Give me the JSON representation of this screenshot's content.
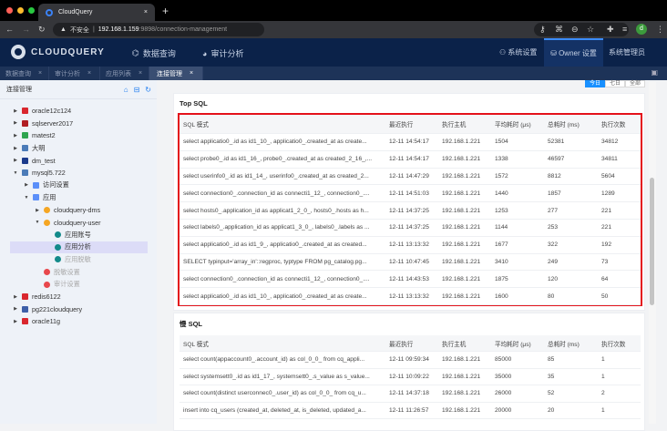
{
  "browser": {
    "tab_title": "CloudQuery",
    "tab_close": "×",
    "new_tab": "+",
    "insecure_label": "不安全",
    "url_host": "192.168.1.159",
    "url_rest": ":9898/connection-management",
    "profile_initial": "d"
  },
  "app": {
    "logo_text": "CLOUDQUERY",
    "nav": [
      "数据查询",
      "审计分析"
    ],
    "right": {
      "system_settings": "系统设置",
      "owner_settings": "Owner 设置",
      "user": "系统管理员"
    }
  },
  "tabs": [
    {
      "label": "数据查询",
      "active": false
    },
    {
      "label": "审计分析",
      "active": false
    },
    {
      "label": "应用列表",
      "active": false
    },
    {
      "label": "连接管理",
      "active": true
    }
  ],
  "sidebar": {
    "title": "连接管理",
    "tree": [
      {
        "label": "oracle12c124",
        "depth": 0,
        "expand": "closed",
        "color": "#d9272e"
      },
      {
        "label": "sqlserver2017",
        "depth": 0,
        "expand": "closed",
        "color": "#b01e23"
      },
      {
        "label": "matest2",
        "depth": 0,
        "expand": "closed",
        "color": "#2ea44f"
      },
      {
        "label": "大明",
        "depth": 0,
        "expand": "closed",
        "color": "#4b7bb8"
      },
      {
        "label": "dm_test",
        "depth": 0,
        "expand": "closed",
        "color": "#1a3a8c"
      },
      {
        "label": "mysql5.722",
        "depth": 0,
        "expand": "open",
        "color": "#4b7bb8"
      },
      {
        "label": "访问设置",
        "depth": 1,
        "expand": "closed",
        "color": "#5b8ff9"
      },
      {
        "label": "应用",
        "depth": 1,
        "expand": "open",
        "color": "#5b8ff9"
      },
      {
        "label": "cloudquery-dms",
        "depth": 2,
        "expand": "closed",
        "color": "#f5a623"
      },
      {
        "label": "cloudquery-user",
        "depth": 2,
        "expand": "open",
        "color": "#f5a623"
      },
      {
        "label": "应用账号",
        "depth": 3,
        "expand": "none",
        "color": "#138a8a"
      },
      {
        "label": "应用分析",
        "depth": 3,
        "expand": "none",
        "color": "#138a8a",
        "selected": true
      },
      {
        "label": "应用脱敏",
        "depth": 3,
        "expand": "none",
        "color": "#138a8a",
        "disabled": true
      },
      {
        "label": "脱敏设置",
        "depth": 2,
        "expand": "none",
        "color": "#e8474c",
        "disabled": true
      },
      {
        "label": "审计设置",
        "depth": 2,
        "expand": "none",
        "color": "#e8474c",
        "disabled": true
      },
      {
        "label": "redis6122",
        "depth": 0,
        "expand": "closed",
        "color": "#d9272e"
      },
      {
        "label": "pg221cloudquery",
        "depth": 0,
        "expand": "closed",
        "color": "#3d5fa8"
      },
      {
        "label": "oracle11g",
        "depth": 0,
        "expand": "closed",
        "color": "#d9272e"
      }
    ]
  },
  "range": [
    "今日",
    "七日",
    "全部"
  ],
  "columns": [
    "SQL 模式",
    "最近执行",
    "执行主机",
    "平均耗时 (μs)",
    "总耗时 (ms)",
    "执行次数"
  ],
  "top_sql": {
    "title": "Top SQL",
    "rows": [
      [
        "select applicatio0_.id as id1_10_, applicatio0_.created_at as create...",
        "12-11 14:54:17",
        "192.168.1.221",
        "1504",
        "52381",
        "34812"
      ],
      [
        "select probe0_.id as id1_16_, probe0_.created_at as created_2_16_,...",
        "12-11 14:54:17",
        "192.168.1.221",
        "1338",
        "46597",
        "34811"
      ],
      [
        "select userinfo0_.id as id1_14_, userinfo0_.created_at as created_2...",
        "12-11 14:47:29",
        "192.168.1.221",
        "1572",
        "8812",
        "5604"
      ],
      [
        "select connection0_.connection_id as connecti1_12_, connection0_....",
        "12-11 14:51:03",
        "192.168.1.221",
        "1440",
        "1857",
        "1289"
      ],
      [
        "select hosts0_.application_id as applicat1_2_0_, hosts0_.hosts as h...",
        "12-11 14:37:25",
        "192.168.1.221",
        "1253",
        "277",
        "221"
      ],
      [
        "select labels0_.application_id as applicat1_3_0_, labels0_.labels as ...",
        "12-11 14:37:25",
        "192.168.1.221",
        "1144",
        "253",
        "221"
      ],
      [
        "select applicatio0_.id as id1_9_, applicatio0_.created_at as created...",
        "12-11 13:13:32",
        "192.168.1.221",
        "1677",
        "322",
        "192"
      ],
      [
        "SELECT typinput='array_in'::regproc, typtype FROM pg_catalog.pg...",
        "12-11 10:47:45",
        "192.168.1.221",
        "3410",
        "249",
        "73"
      ],
      [
        "select connection0_.connection_id as connecti1_12_, connection0_....",
        "12-11 14:43:53",
        "192.168.1.221",
        "1875",
        "120",
        "64"
      ],
      [
        "select applicatio0_.id as id1_10_, applicatio0_.created_at as create...",
        "12-11 13:13:32",
        "192.168.1.221",
        "1600",
        "80",
        "50"
      ]
    ]
  },
  "slow_sql": {
    "title": "慢 SQL",
    "rows": [
      [
        "select count(appaccount0_.account_id) as col_0_0_ from cq_appli...",
        "12-11 09:59:34",
        "192.168.1.221",
        "85000",
        "85",
        "1"
      ],
      [
        "select systemsett0_.id as id1_17_, systemsett0_.s_value as s_value...",
        "12-11 10:09:22",
        "192.168.1.221",
        "35000",
        "35",
        "1"
      ],
      [
        "select count(distinct userconnec0_.user_id) as col_0_0_ from cq_u...",
        "12-11 14:37:18",
        "192.168.1.221",
        "26000",
        "52",
        "2"
      ],
      [
        "insert into cq_users (created_at, deleted_at, is_deleted, updated_a...",
        "12-11 11:26:57",
        "192.168.1.221",
        "20000",
        "20",
        "1"
      ]
    ]
  }
}
